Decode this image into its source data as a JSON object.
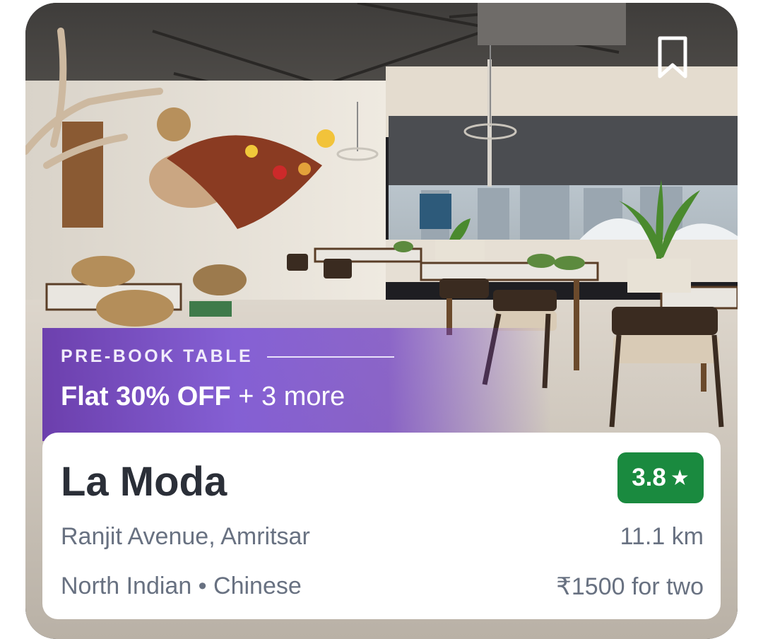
{
  "promo": {
    "kicker": "PRE-BOOK TABLE",
    "offer_main": "Flat 30% OFF",
    "offer_extra": " + 3 more"
  },
  "restaurant": {
    "name": "La Moda",
    "rating": "3.8",
    "rating_color": "#1a8a3f",
    "location": "Ranjit Avenue, Amritsar",
    "distance": "11.1 km",
    "cuisines": "North Indian • Chinese",
    "price": "₹1500 for two"
  },
  "icons": {
    "bookmark": "bookmark-outline-icon",
    "rating_star": "star-icon"
  }
}
